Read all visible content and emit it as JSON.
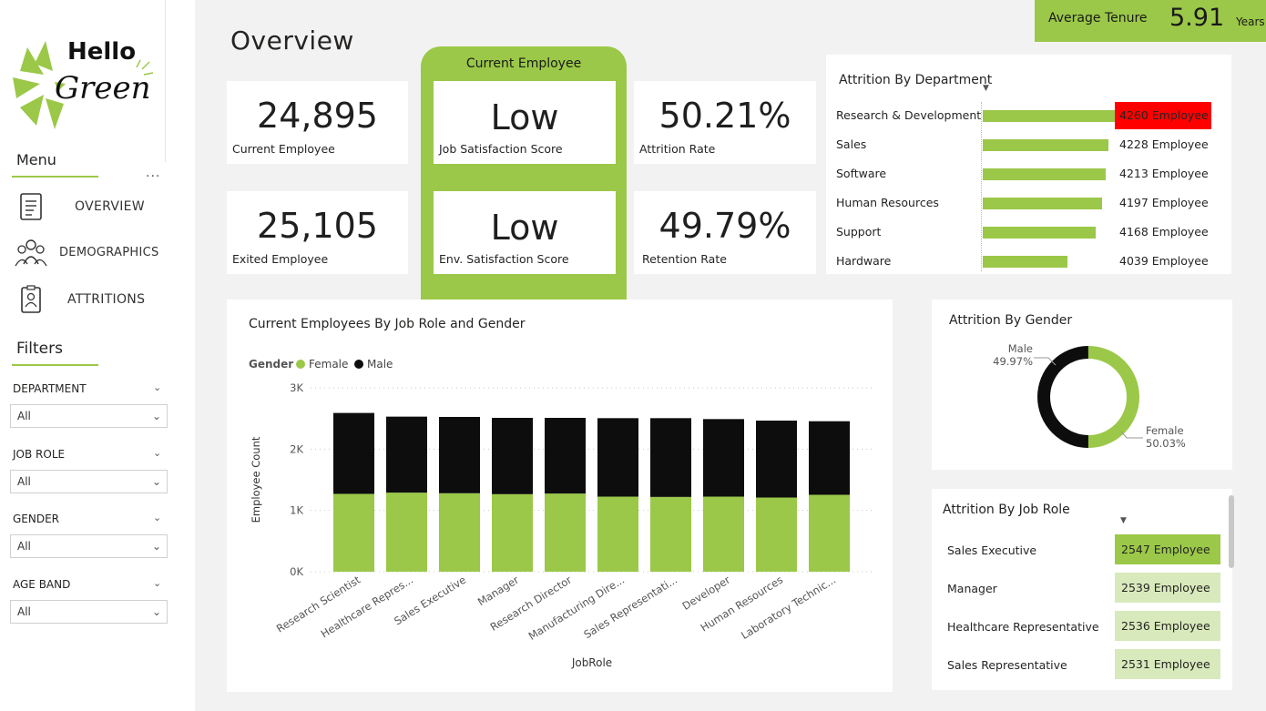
{
  "logo": {
    "line1": "Hello",
    "line2": "Green"
  },
  "menu": {
    "title": "Menu",
    "more": "...",
    "items": [
      {
        "label": "OVERVIEW",
        "icon": "document-icon"
      },
      {
        "label": "DEMOGRAPHICS",
        "icon": "people-icon"
      },
      {
        "label": "ATTRITIONS",
        "icon": "badge-icon"
      }
    ]
  },
  "filters": {
    "title": "Filters",
    "items": [
      {
        "label": "DEPARTMENT",
        "value": "All"
      },
      {
        "label": "JOB ROLE",
        "value": "All"
      },
      {
        "label": "GENDER",
        "value": "All"
      },
      {
        "label": "AGE BAND",
        "value": "All"
      }
    ]
  },
  "page_title": "Overview",
  "tenure": {
    "label": "Average Tenure",
    "value": "5.91",
    "unit": "Years"
  },
  "kpis": {
    "current_employee": {
      "value": "24,895",
      "label": "Current Employee"
    },
    "exited_employee": {
      "value": "25,105",
      "label": "Exited Employee"
    },
    "job_satisfaction": {
      "value": "Low",
      "label": "Job Satisfaction Score"
    },
    "env_satisfaction": {
      "value": "Low",
      "label": "Env. Satisfaction Score"
    },
    "attrition_rate": {
      "value": "50.21%",
      "label": "Attrition Rate"
    },
    "retention_rate": {
      "value": "49.79%",
      "label": "Retention Rate"
    },
    "panel_title": "Current Employee"
  },
  "dept": {
    "title": "Attrition By Department",
    "rows": [
      {
        "name": "Research & Development",
        "value": 4260,
        "label": "4260 Employee",
        "highlight": true
      },
      {
        "name": "Sales",
        "value": 4228,
        "label": "4228 Employee",
        "highlight": false
      },
      {
        "name": "Software",
        "value": 4213,
        "label": "4213 Employee",
        "highlight": false
      },
      {
        "name": "Human Resources",
        "value": 4197,
        "label": "4197 Employee",
        "highlight": false
      },
      {
        "name": "Support",
        "value": 4168,
        "label": "4168 Employee",
        "highlight": false
      },
      {
        "name": "Hardware",
        "value": 4039,
        "label": "4039 Employee",
        "highlight": false
      }
    ]
  },
  "chart_data": [
    {
      "type": "bar",
      "title": "Current Employees By Job Role and Gender",
      "xlabel": "JobRole",
      "ylabel": "Employee Count",
      "legend_title": "Gender",
      "stacked": true,
      "categories": [
        "Research Scientist",
        "Healthcare Repres...",
        "Sales Executive",
        "Manager",
        "Research Director",
        "Manufacturing Dire...",
        "Sales Representati...",
        "Developer",
        "Human Resources",
        "Laboratory Technic..."
      ],
      "series": [
        {
          "name": "Female",
          "color": "#9bc848",
          "values": [
            1270,
            1290,
            1280,
            1265,
            1275,
            1225,
            1220,
            1225,
            1210,
            1255
          ]
        },
        {
          "name": "Male",
          "color": "#0d0d0d",
          "values": [
            1320,
            1240,
            1245,
            1245,
            1235,
            1280,
            1285,
            1265,
            1255,
            1200
          ]
        }
      ],
      "yticks": [
        "0K",
        "1K",
        "2K",
        "3K"
      ],
      "ylim": [
        0,
        3000
      ]
    },
    {
      "type": "pie",
      "title": "Attrition By Gender",
      "donut": true,
      "slices": [
        {
          "name": "Male",
          "value": 49.97,
          "label": "49.97%",
          "color": "#0d0d0d"
        },
        {
          "name": "Female",
          "value": 50.03,
          "label": "50.03%",
          "color": "#9bc848"
        }
      ]
    }
  ],
  "ajr": {
    "title": "Attrition By Job Role",
    "rows": [
      {
        "name": "Sales Executive",
        "label": "2547 Employee",
        "strong": true
      },
      {
        "name": "Manager",
        "label": "2539 Employee",
        "strong": false
      },
      {
        "name": "Healthcare Representative",
        "label": "2536 Employee",
        "strong": false
      },
      {
        "name": "Sales Representative",
        "label": "2531 Employee",
        "strong": false
      }
    ]
  },
  "colors": {
    "accent": "#9bc848",
    "accent_light": "#d8e9bb",
    "highlight": "#ff0000",
    "dark": "#0d0d0d"
  }
}
